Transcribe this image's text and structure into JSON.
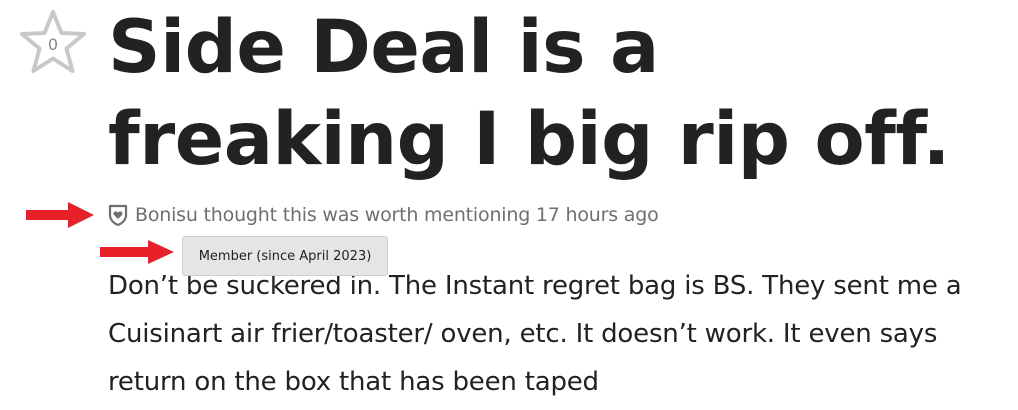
{
  "post": {
    "vote_count": "0",
    "title": "Side Deal is a freaking I big rip off.",
    "meta_text": "Bonisu thought this was worth mentioning 17 hours ago",
    "badge_tooltip": "Member (since April 2023)",
    "body": "Don’t be suckered in. The Instant regret bag is BS. They sent me a Cuisinart air frier/toaster/ oven, etc. It doesn’t work. It even says return on the box that has been taped"
  },
  "icons": {
    "vote": "star-icon",
    "badge": "member-shield-icon",
    "annotation": "arrow-right-icon"
  },
  "colors": {
    "star_outline": "#c8c8c8",
    "annotation_arrow": "#e8202a",
    "meta_text": "#6f6f6f",
    "tooltip_bg": "#e5e5e5"
  }
}
